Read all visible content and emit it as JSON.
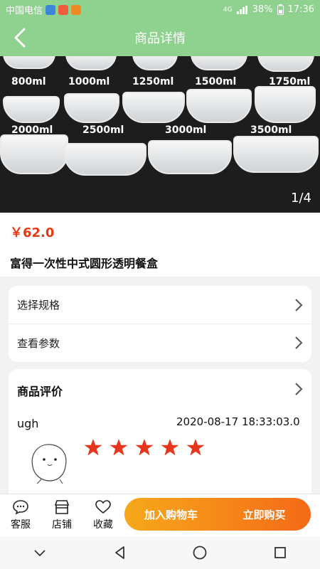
{
  "status_bar": {
    "carrier": "中国电信",
    "signal": "4G",
    "battery": "38%",
    "time": "17:36"
  },
  "header": {
    "title": "商品详情",
    "back_icon": "back-icon"
  },
  "gallery": {
    "pager": "1/4",
    "labels": [
      "800ml",
      "1000ml",
      "1250ml",
      "1500ml",
      "1750ml",
      "2000ml",
      "2500ml",
      "3000ml",
      "3500ml"
    ]
  },
  "product": {
    "price": "￥62.0",
    "name": "富得一次性中式圆形透明餐盒"
  },
  "options": {
    "spec_label": "选择规格",
    "params_label": "查看参数"
  },
  "reviews": {
    "title": "商品评价",
    "user": "ugh",
    "date": "2020-08-17 18:33:03.0",
    "rating": 5
  },
  "bottom_bar": {
    "service": "客服",
    "shop": "店铺",
    "favorite": "收藏",
    "add_to_cart": "加入购物车",
    "buy_now": "立即购买"
  },
  "colors": {
    "header_bg": "#8fd18f",
    "price": "#e53a16",
    "star": "#e8361c",
    "cta_start": "#f6a81b",
    "cta_end": "#f56a17"
  }
}
